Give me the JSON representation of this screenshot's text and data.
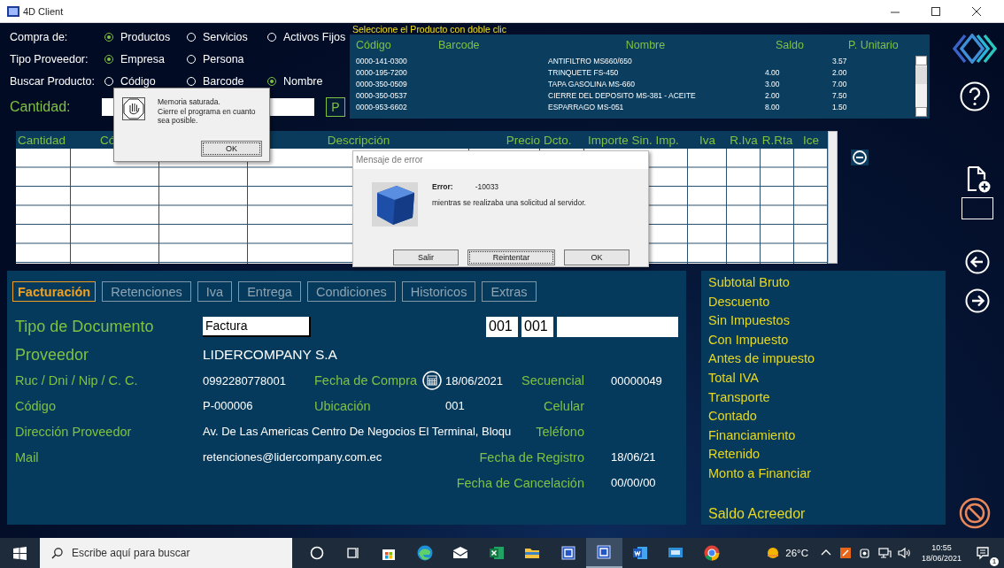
{
  "window": {
    "title": "4D Client"
  },
  "filters": [
    {
      "label": "Compra de:",
      "options": [
        {
          "label": "Productos",
          "selected": true
        },
        {
          "label": "Servicios",
          "selected": false
        },
        {
          "label": "Activos Fijos",
          "selected": false
        }
      ]
    },
    {
      "label": "Tipo Proveedor:",
      "options": [
        {
          "label": "Empresa",
          "selected": true
        },
        {
          "label": "Persona",
          "selected": false
        }
      ]
    },
    {
      "label": "Buscar Producto:",
      "options": [
        {
          "label": "Código",
          "selected": false
        },
        {
          "label": "Barcode",
          "selected": false
        },
        {
          "label": "Nombre",
          "selected": true
        }
      ]
    }
  ],
  "quantity": {
    "label": "Cantidad:",
    "button": "P"
  },
  "product_list": {
    "caption": "Seleccione el Producto con doble clic",
    "columns": [
      "Código",
      "Barcode",
      "Nombre",
      "Saldo",
      "P. Unitario"
    ],
    "rows": [
      [
        "0000-141-0300",
        "",
        "ANTIFILTRO MS660/650",
        "",
        "3.57"
      ],
      [
        "0000-195-7200",
        "",
        "TRINQUETE FS-450",
        "4.00",
        "2.00"
      ],
      [
        "0000-350-0509",
        "",
        "TAPA GASOLINA MS-660",
        "3.00",
        "7.00"
      ],
      [
        "0000-350-0537",
        "",
        "CIERRE DEL DEPOSITO MS-381 - ACEITE",
        "2.00",
        "7.50"
      ],
      [
        "0000-953-6602",
        "",
        "ESPARRAGO MS-051",
        "8.00",
        "1.50"
      ]
    ]
  },
  "line_items": {
    "columns": [
      {
        "label": "Cantidad"
      },
      {
        "label": "Có"
      },
      {},
      {
        "label": "Descripción"
      },
      {
        "label": "Precio"
      },
      {
        "label": "Dcto."
      },
      {
        "label": "Importe Sin. Imp."
      },
      {
        "label": "Iva"
      },
      {
        "label": "R.Iva"
      },
      {
        "label": "R.Rta"
      },
      {
        "label": "Ice"
      }
    ]
  },
  "tabs": [
    {
      "label": "Facturación",
      "selected": true
    },
    {
      "label": "Retenciones",
      "selected": false
    },
    {
      "label": "Iva",
      "selected": false
    },
    {
      "label": "Entrega",
      "selected": false
    },
    {
      "label": "Condiciones",
      "selected": false
    },
    {
      "label": "Historicos",
      "selected": false
    },
    {
      "label": "Extras",
      "selected": false
    }
  ],
  "document": {
    "type_label": "Tipo de Documento",
    "type_value": "Factura",
    "serie_1": "001",
    "serie_2": "001",
    "supplier_label": "Proveedor",
    "supplier": "LIDERCOMPANY S.A",
    "ruc_label": "Ruc / Dni / Nip / C. C.",
    "ruc": "0992280778001",
    "purchase_date_label": "Fecha de Compra",
    "purchase_date": "18/06/2021",
    "sequence_label": "Secuencial",
    "sequence": "00000049",
    "code_label": "Código",
    "code": "P-000006",
    "location_label": "Ubicación",
    "location": "001",
    "mobile_label": "Celular",
    "address_label": "Dirección Proveedor",
    "address": "Av. De Las Americas Centro De Negocios El Terminal, Bloqu",
    "phone_label": "Teléfono",
    "mail_label": "Mail",
    "mail": "retenciones@lidercompany.com.ec",
    "registration_date_label": "Fecha de Registro",
    "registration_date": "18/06/21",
    "cancel_date_label": "Fecha de Cancelación",
    "cancel_date": "00/00/00"
  },
  "totals": {
    "items": [
      "Subtotal Bruto",
      "Descuento",
      "Sin Impuestos",
      "Con Impuesto",
      "Antes de impuesto",
      "Total IVA",
      "Transporte",
      "Contado",
      "Financiamiento",
      "Retenido",
      "Monto a Financiar"
    ],
    "balance_label": "Saldo Acreedor"
  },
  "memory_alert": {
    "message": "Memoria saturada.\nCierre el programa en cuanto sea posible.",
    "button": "OK"
  },
  "error_dialog": {
    "title": "Mensaje de error",
    "error_label": "Error:",
    "error_code": "-10033",
    "message": "mientras se realizaba una solicitud al servidor.",
    "buttons": [
      {
        "label": "Salir",
        "focused": false
      },
      {
        "label": "Reintentar",
        "focused": true
      },
      {
        "label": "OK",
        "focused": false
      }
    ]
  },
  "taskbar": {
    "search_placeholder": "Escribe aquí para buscar",
    "apps": [
      {
        "kind": "cortana",
        "active": false
      },
      {
        "kind": "taskview",
        "active": false
      },
      {
        "kind": "store",
        "active": false
      },
      {
        "kind": "edge",
        "active": false
      },
      {
        "kind": "mail",
        "active": false
      },
      {
        "kind": "excel",
        "active": false
      },
      {
        "kind": "explorer",
        "active": false
      },
      {
        "kind": "fourd",
        "active": false
      },
      {
        "kind": "fourd",
        "active": true
      },
      {
        "kind": "word",
        "active": false
      },
      {
        "kind": "remote",
        "active": false
      },
      {
        "kind": "chrome",
        "active": false
      }
    ],
    "temperature": "26°C",
    "time": "10:55",
    "date": "18/06/2021",
    "notification_count": "1"
  }
}
